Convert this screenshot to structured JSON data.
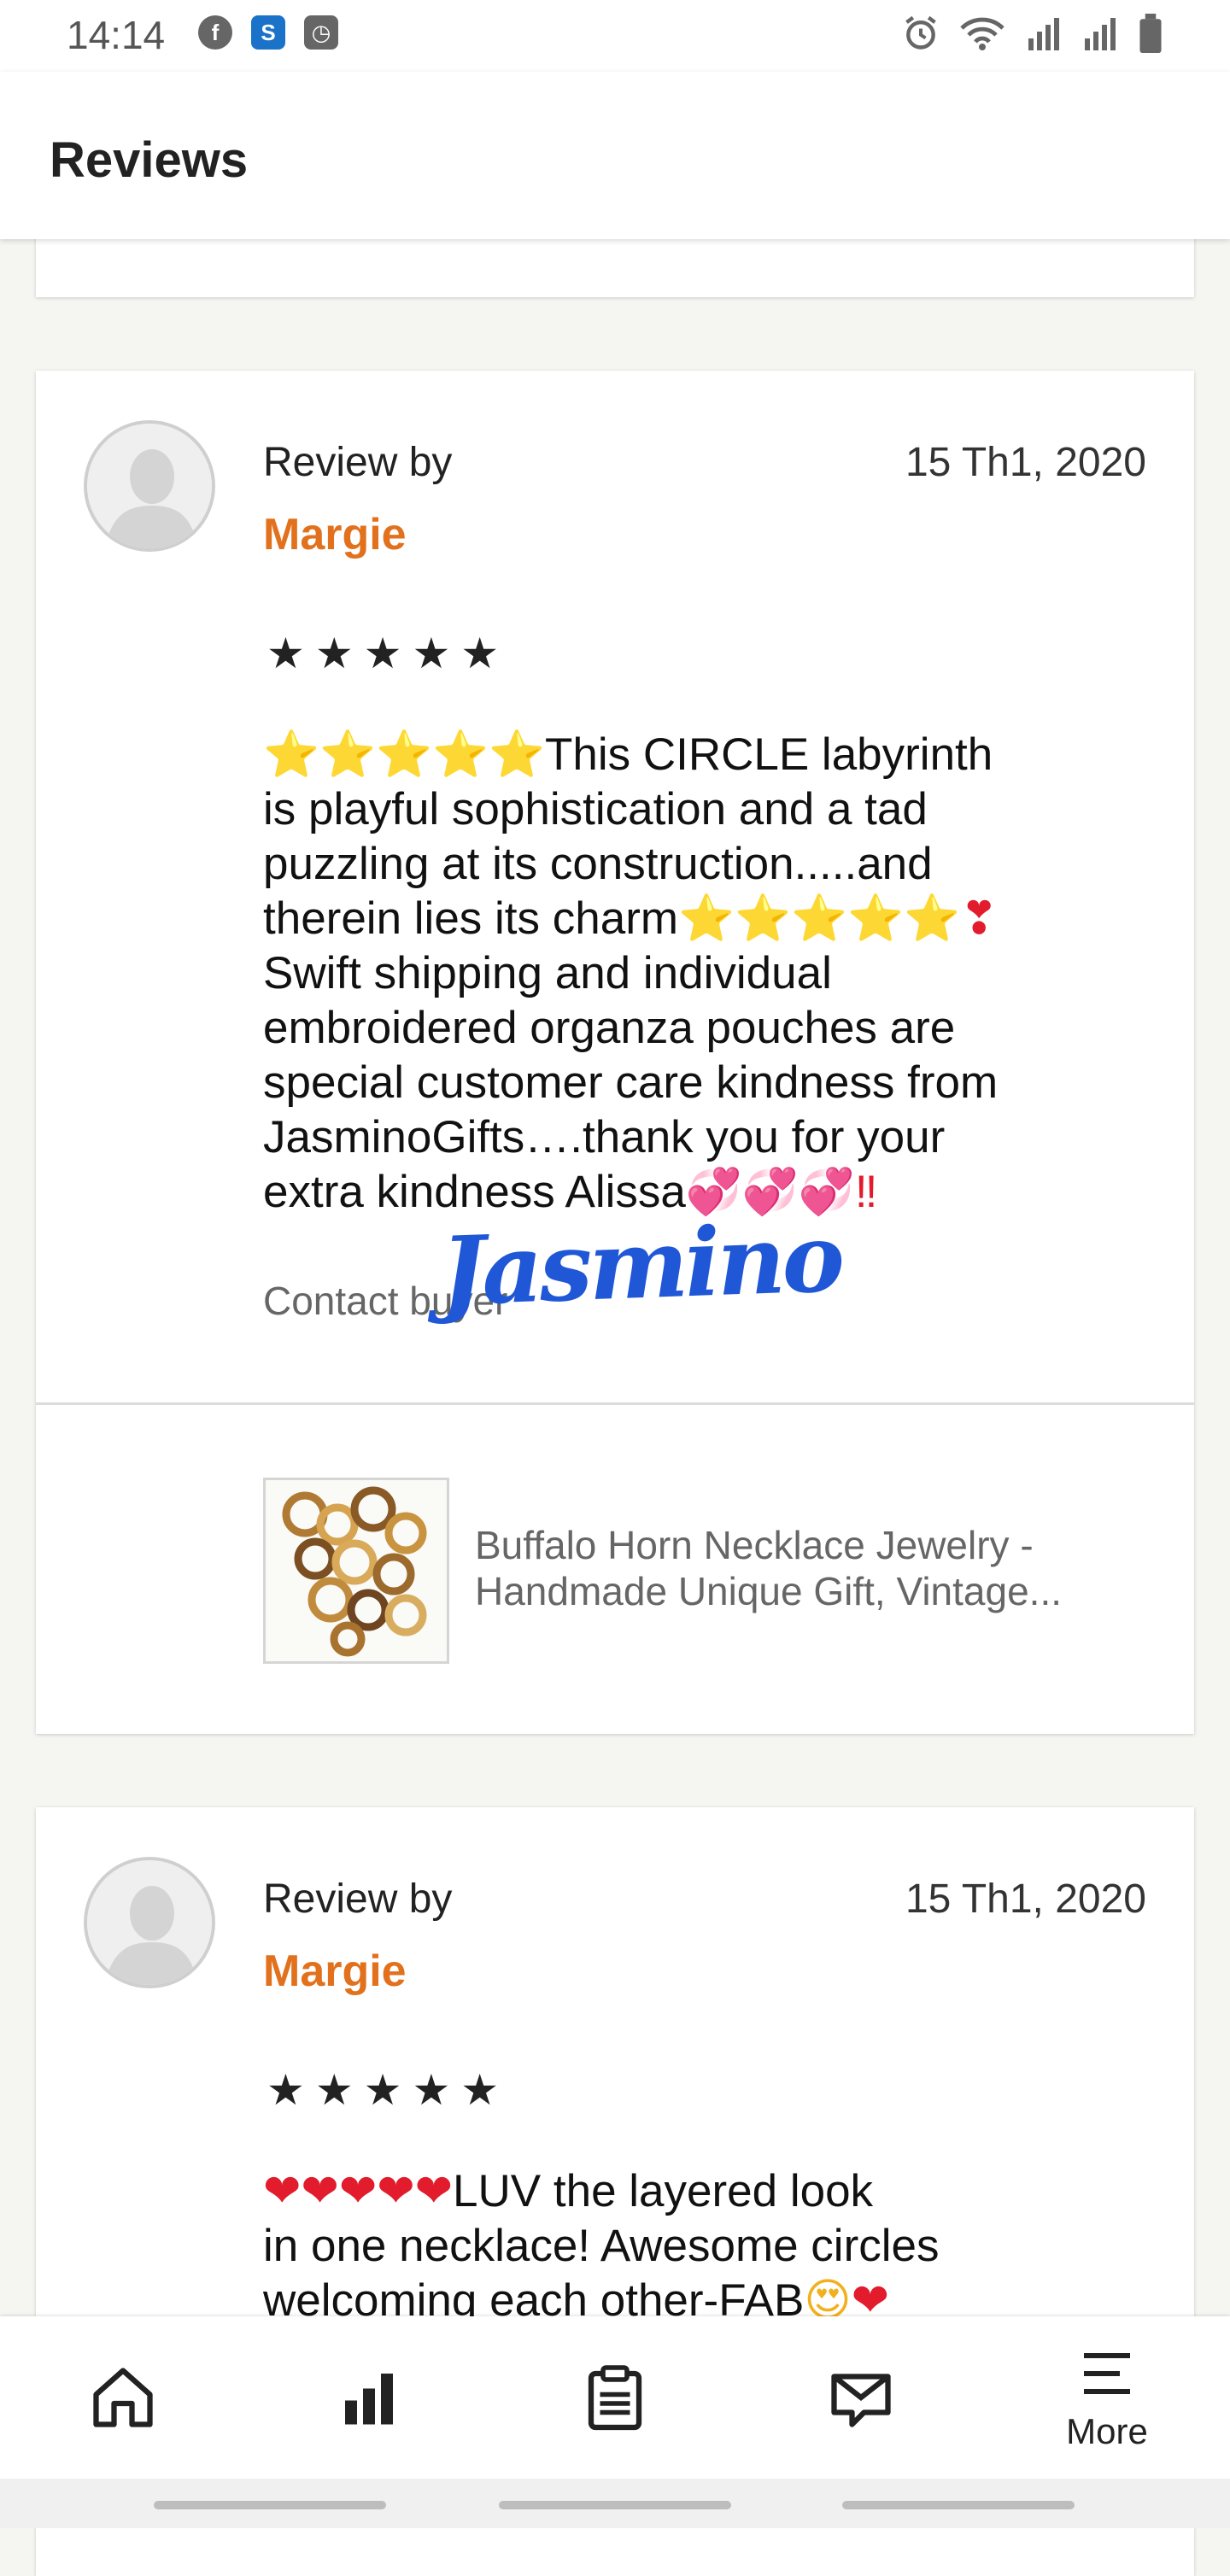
{
  "status_bar": {
    "time": "14:14",
    "left_icons": [
      "facebook-icon",
      "s-app-icon",
      "clock-app-icon"
    ],
    "right_icons": [
      "alarm-icon",
      "wifi-icon",
      "signal-icon",
      "signal-icon",
      "battery-icon"
    ]
  },
  "header": {
    "title": "Reviews"
  },
  "reviews": [
    {
      "review_by_label": "Review by",
      "reviewer": "Margie",
      "date": "15 Th1, 2020",
      "stars": "★★★★★",
      "rating": 5,
      "text_line_1_emoji": "⭐⭐⭐⭐⭐",
      "text_line_1": "This CIRCLE labyrinth",
      "text_line_2": "is playful sophistication and a tad",
      "text_line_3": "puzzling at its construction.....and",
      "text_line_4": "therein lies its charm",
      "text_line_4_emoji": "⭐⭐⭐⭐⭐",
      "text_line_4_heart": "❣",
      "text_line_5": "Swift shipping and individual",
      "text_line_6": "embroidered organza pouches are",
      "text_line_7": "special customer care kindness from",
      "text_line_8": "JasminoGifts….thank you for your",
      "text_line_9": "extra kindness Alissa",
      "text_line_9_emoji": "💞💞💞",
      "text_line_9_mark": "‼",
      "contact_buyer": "Contact buyer",
      "watermark": "Jasmino",
      "product_title": "Buffalo Horn Necklace Jewelry - Handmade Unique Gift, Vintage..."
    },
    {
      "review_by_label": "Review by",
      "reviewer": "Margie",
      "date": "15 Th1, 2020",
      "stars": "★★★★★",
      "rating": 5,
      "text_line_1_emoji": "❤❤❤❤❤",
      "text_line_1": "LUV the layered look",
      "text_line_2": "in one necklace! Awesome circles",
      "text_line_3": "welcoming each other-FAB",
      "text_line_3_emoji": "😍",
      "text_line_3_heart": "❤"
    }
  ],
  "bottom_nav": {
    "items": [
      {
        "icon": "home-icon"
      },
      {
        "icon": "stats-icon"
      },
      {
        "icon": "clipboard-icon"
      },
      {
        "icon": "mail-icon"
      },
      {
        "icon": "menu-icon",
        "label": "More"
      }
    ]
  },
  "colors": {
    "accent": "#e2711d",
    "background": "#f5f5f1",
    "watermark": "#1f57d6"
  }
}
